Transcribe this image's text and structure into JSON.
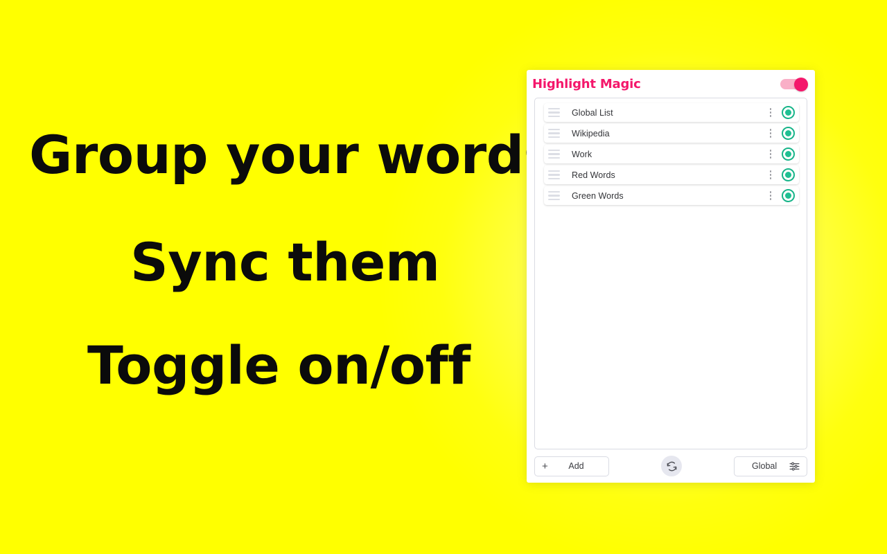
{
  "page": {
    "background_color": "#FFFF00",
    "glow_color": "#FFFFFF"
  },
  "promo": {
    "taglines": [
      "Group your words",
      "Sync them",
      "Toggle on/off"
    ]
  },
  "panel": {
    "title": "Highlight Magic",
    "title_color": "#F4176B",
    "master_toggle": {
      "name": "master-enable-toggle",
      "state": "on",
      "on_color": "#F4176B",
      "track_color": "#F9AFC7"
    },
    "groups": [
      {
        "name": "Global List",
        "toggle_state": "on",
        "drag_icon": "drag-handle-icon",
        "menu_icon": "kebab-menu-icon",
        "toggle_icon": "radio-on-icon"
      },
      {
        "name": "Wikipedia",
        "toggle_state": "on",
        "drag_icon": "drag-handle-icon",
        "menu_icon": "kebab-menu-icon",
        "toggle_icon": "radio-on-icon"
      },
      {
        "name": "Work",
        "toggle_state": "on",
        "drag_icon": "drag-handle-icon",
        "menu_icon": "kebab-menu-icon",
        "toggle_icon": "radio-on-icon"
      },
      {
        "name": "Red Words",
        "toggle_state": "on",
        "drag_icon": "drag-handle-icon",
        "menu_icon": "kebab-menu-icon",
        "toggle_icon": "radio-on-icon"
      },
      {
        "name": "Green Words",
        "toggle_state": "on",
        "drag_icon": "drag-handle-icon",
        "menu_icon": "kebab-menu-icon",
        "toggle_icon": "radio-on-icon"
      }
    ],
    "group_toggle_color": "#1FBF92",
    "footer": {
      "add_button": {
        "plus": "+",
        "label": "Add",
        "icon": "plus-icon"
      },
      "sync_button": {
        "icon": "sync-refresh-icon",
        "label": ""
      },
      "scope_button": {
        "label": "Global",
        "icon": "sliders-settings-icon"
      }
    }
  }
}
